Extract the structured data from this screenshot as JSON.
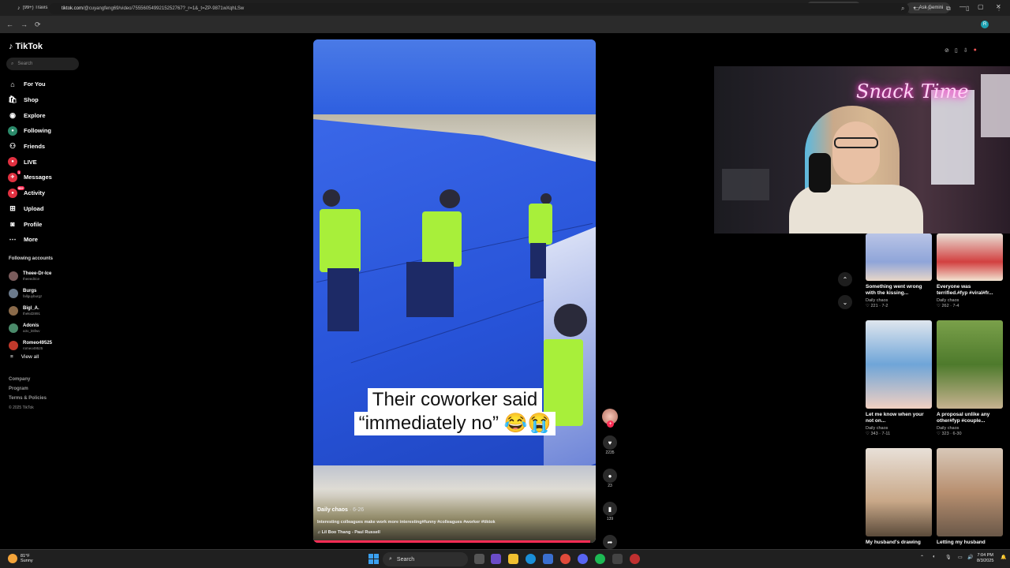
{
  "browser": {
    "tabs": [
      {
        "label": "(99+) Travis",
        "icon": "tiktok-icon"
      },
      {
        "label": "(99+) #Balli",
        "icon": "tiktok-icon"
      },
      {
        "label": "(99+) Why Y",
        "icon": "tiktok-icon"
      },
      {
        "label": "(99+) One o",
        "icon": "tiktok-icon"
      },
      {
        "label": "(99+) Midni",
        "icon": "tiktok-icon"
      },
      {
        "label": "(99+) #fyp",
        "icon": "tiktok-icon"
      },
      {
        "label": "(99+) He wa",
        "icon": "tiktok-icon"
      },
      {
        "label": "(99+) Filipin",
        "icon": "tiktok-icon"
      },
      {
        "label": "(99+) How t",
        "icon": "tiktok-icon"
      },
      {
        "label": "Instagram",
        "icon": "instagram-icon"
      },
      {
        "label": "(99+) He wa",
        "icon": "tiktok-icon"
      },
      {
        "label": "(99+) Husba",
        "icon": "tiktok-icon"
      },
      {
        "label": "(99+) TikTo",
        "icon": "tiktok-icon"
      },
      {
        "label": "(99+) Anyo",
        "icon": "tiktok-icon"
      },
      {
        "label": "(99+) Villain",
        "icon": "tiktok-icon"
      },
      {
        "label": "(99+) In",
        "icon": "tiktok-icon",
        "active": true
      }
    ],
    "new_tab": "+",
    "gemini": "Ask Gemini",
    "url_site": "tiktok.com",
    "url_path": "/@cuyangfeng69/video/7555605499215252767?_r=1&_t=ZP-9871wXqhLSw",
    "profile_initial": "R"
  },
  "sidebar": {
    "logo": "TikTok",
    "search_placeholder": "Search",
    "nav": [
      {
        "label": "For You",
        "icon": "home-icon"
      },
      {
        "label": "Shop",
        "icon": "shop-icon"
      },
      {
        "label": "Explore",
        "icon": "compass-icon"
      },
      {
        "label": "Following",
        "icon": "following-icon"
      },
      {
        "label": "Friends",
        "icon": "friends-icon"
      },
      {
        "label": "LIVE",
        "icon": "live-icon"
      },
      {
        "label": "Messages",
        "icon": "messages-icon",
        "badge": "1"
      },
      {
        "label": "Activity",
        "icon": "activity-icon",
        "badge": "99+"
      },
      {
        "label": "Upload",
        "icon": "upload-icon"
      },
      {
        "label": "Profile",
        "icon": "profile-icon"
      },
      {
        "label": "More",
        "icon": "more-icon"
      }
    ],
    "following_title": "Following accounts",
    "accounts": [
      {
        "name": "Theee-Dr-Ice",
        "handle": "theeedrice",
        "color": "#7a5c5c"
      },
      {
        "name": "Burgs",
        "handle": "fallguyburgz",
        "color": "#6b7a8c"
      },
      {
        "name": "Bigl_A.",
        "handle": "thekid2891",
        "color": "#8a6a4a"
      },
      {
        "name": "Adonis",
        "handle": "a3o_k5fwv",
        "color": "#4a8a6a"
      },
      {
        "name": "Romeo49525",
        "handle": "romeo49525",
        "color": "#c0392b"
      }
    ],
    "view_all": "View all",
    "footer": [
      "Company",
      "Program",
      "Terms & Policies"
    ],
    "copyright": "© 2025 TikTok"
  },
  "video": {
    "caption_line1": "Their coworker said",
    "caption_line2": "“immediately no” 😂😭",
    "author": "Daily chaos",
    "date": "· 6-26",
    "description": "Interesting colleagues make work more interesting#funny #colleagues #worker #tiktok",
    "music": "Lil Boo Thang - Paul Russell",
    "progress": 0.98
  },
  "actions": {
    "likes": "2235",
    "comments": "23",
    "saves": "139",
    "shares": "257"
  },
  "webcam": {
    "neon_sign": "Snack Time"
  },
  "recommended": [
    {
      "title": "Something went wrong with the kissing...",
      "author": "Daily chaos",
      "likes": "221",
      "date": "7-2"
    },
    {
      "title": "Everyone was terrified.#fyp #viral#fr...",
      "author": "Daily chaos",
      "likes": "262",
      "date": "7-4"
    },
    {
      "title": "Let me know when your not on...",
      "author": "Daily chaos",
      "likes": "343",
      "date": "7-11"
    },
    {
      "title": "A proposal unlike any other#fyp #couple...",
      "author": "Daily chaos",
      "likes": "323",
      "date": "6-30"
    },
    {
      "title": "My husband's drawing",
      "author": "",
      "likes": "",
      "date": ""
    },
    {
      "title": "Letting my husband",
      "author": "",
      "likes": "",
      "date": ""
    }
  ],
  "taskbar": {
    "weather_temp": "81°F",
    "weather_cond": "Sunny",
    "search": "Search",
    "time": "7:04 PM",
    "date": "8/3/2025"
  }
}
